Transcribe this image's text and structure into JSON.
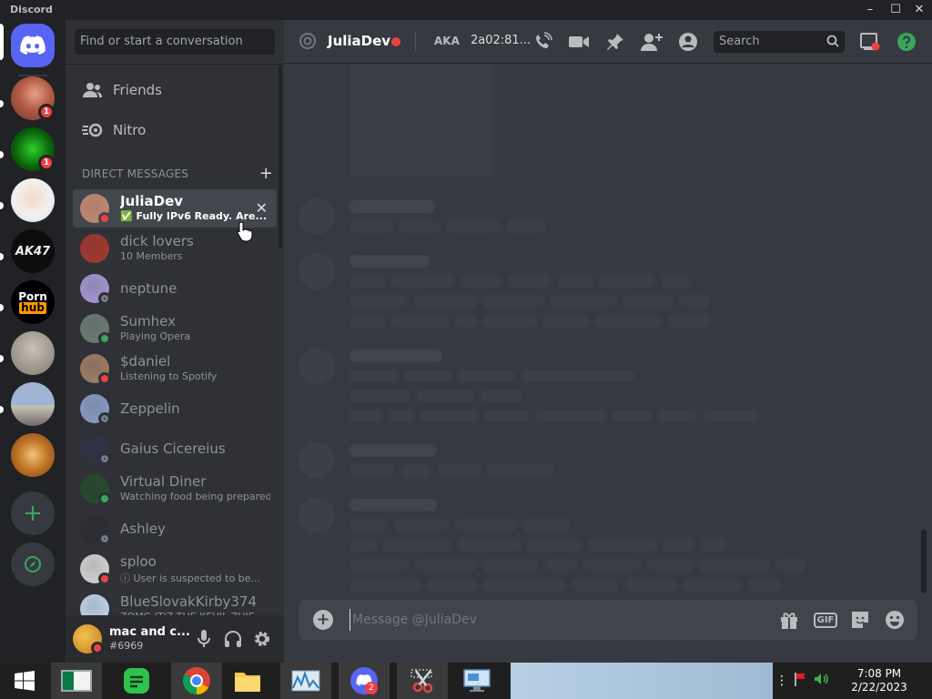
{
  "window": {
    "title": "Discord",
    "min": "–",
    "max": "☐",
    "close": "✕"
  },
  "servers": [
    {
      "name": "home",
      "color": "#5865f2"
    },
    {
      "name": "server-avatar-1",
      "badge": "1",
      "color": "#c06a54"
    },
    {
      "name": "server-trollface",
      "badge": "1",
      "color": "#1f3d12"
    },
    {
      "name": "server-cartoon",
      "color": "#e8e8e8"
    },
    {
      "name": "server-ak47",
      "color": "#111111"
    },
    {
      "name": "server-porn-hub",
      "logo_line1": "Porn",
      "logo_line2": "hub",
      "color": "#000000"
    },
    {
      "name": "server-photo-gray",
      "color": "#a4a09a"
    },
    {
      "name": "server-building",
      "color": "#7b8fb0"
    },
    {
      "name": "server-burger",
      "color": "#d08a3c"
    }
  ],
  "rail": {
    "add": "+",
    "explore": "◈"
  },
  "sidebar": {
    "search_placeholder": "Find or start a conversation",
    "friends_label": "Friends",
    "nitro_label": "Nitro",
    "dm_header": "DIRECT MESSAGES",
    "dm_add": "+",
    "dms": [
      {
        "name": "JuliaDev",
        "sub": "✅ Fully IPv6 Ready. Are...",
        "status": "dnd",
        "color": "#c98b73",
        "active": true,
        "close": "✕"
      },
      {
        "name": "dick lovers",
        "sub": "10 Members",
        "status": "none",
        "color": "#a53a2f"
      },
      {
        "name": "neptune",
        "sub": "",
        "status": "offline",
        "color": "#a99bd6"
      },
      {
        "name": "Sumhex",
        "sub": "Playing Opera",
        "status": "online",
        "color": "#6f7e76"
      },
      {
        "name": "$daniel",
        "sub": "Listening to Spotify",
        "status": "dnd",
        "color": "#a18066"
      },
      {
        "name": "Zeppelin",
        "sub": "",
        "status": "offline",
        "color": "#8ca0c7"
      },
      {
        "name": "Gaius Cicereius",
        "sub": "",
        "status": "offline",
        "color": "#2d3344"
      },
      {
        "name": "Virtual Diner",
        "sub": "Watching food being prepared!",
        "status": "online",
        "color": "#274b2d"
      },
      {
        "name": "Ashley",
        "sub": "",
        "status": "offline",
        "color": "#2b2d31"
      },
      {
        "name": "sploo",
        "sub": "ⓘ User is suspected to be...",
        "status": "dnd",
        "color": "#d9d9d9"
      },
      {
        "name": "BlueSlovakKirby374",
        "sub": "ZOMG IT'Z THE KEVIL ZHIE",
        "status": "none",
        "color": "#c6d8ef"
      }
    ]
  },
  "user": {
    "name": "mac and c...",
    "tag": "#6969",
    "status": "dnd"
  },
  "header": {
    "channel_name": "JuliaDev",
    "aka_label": "AKA",
    "aka_value": "2a02:81...",
    "search_placeholder": "Search"
  },
  "composer": {
    "placeholder": "Message @JuliaDev",
    "gif_label": "GIF"
  },
  "taskbar": {
    "apps": [
      "start-button",
      "app-green-window",
      "app-chat-green",
      "chrome",
      "file-explorer",
      "task-manager",
      "discord",
      "snipping-tool",
      "remote-desktop"
    ],
    "discord_badge": "2",
    "time": "7:08 PM",
    "date": "2/22/2023"
  },
  "colors": {
    "accent": "#5865f2",
    "dnd": "#ed4245",
    "online": "#3ba55d",
    "sidebar_bg": "#2f3136",
    "main_bg": "#36393f"
  }
}
